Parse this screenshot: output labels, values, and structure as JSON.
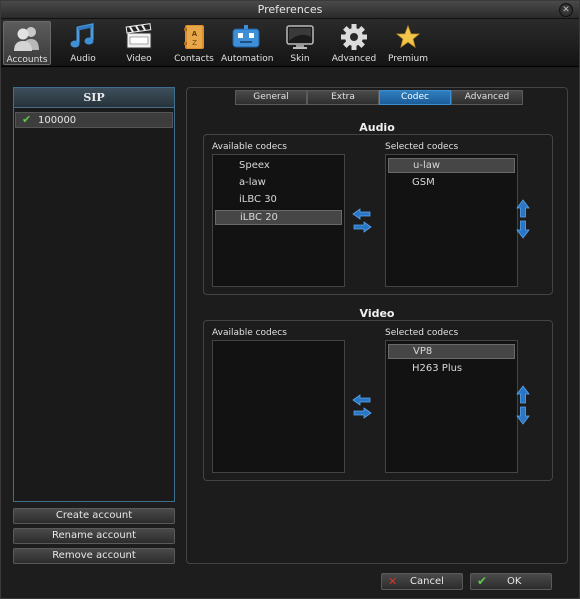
{
  "window": {
    "title": "Preferences",
    "close_glyph": "✕"
  },
  "toolbar": {
    "items": [
      {
        "label": "Accounts",
        "icon": "accounts-icon",
        "active": true
      },
      {
        "label": "Audio",
        "icon": "music-note-icon"
      },
      {
        "label": "Video",
        "icon": "clapperboard-icon"
      },
      {
        "label": "Contacts",
        "icon": "address-book-icon"
      },
      {
        "label": "Automation",
        "icon": "robot-icon"
      },
      {
        "label": "Skin",
        "icon": "monitor-icon"
      },
      {
        "label": "Advanced",
        "icon": "gear-icon"
      },
      {
        "label": "Premium",
        "icon": "star-icon"
      }
    ]
  },
  "accounts": {
    "header": "SIP",
    "list": [
      {
        "name": "100000",
        "checked": true
      }
    ],
    "buttons": {
      "create": "Create account",
      "rename": "Rename account",
      "remove": "Remove account"
    }
  },
  "tabs": [
    {
      "label": "General"
    },
    {
      "label": "Extra"
    },
    {
      "label": "Codec",
      "selected": true
    },
    {
      "label": "Advanced"
    }
  ],
  "audio": {
    "title": "Audio",
    "available_label": "Available codecs",
    "selected_label": "Selected codecs",
    "available": [
      "Speex",
      "a-law",
      "iLBC 30",
      "iLBC 20"
    ],
    "available_selected": "iLBC 20",
    "selected": [
      "u-law",
      "GSM"
    ],
    "selected_selected": "u-law"
  },
  "video": {
    "title": "Video",
    "available_label": "Available codecs",
    "selected_label": "Selected codecs",
    "available": [],
    "selected": [
      "VP8",
      "H263 Plus"
    ],
    "selected_selected": "VP8"
  },
  "footer": {
    "cancel": "Cancel",
    "ok": "OK"
  },
  "colors": {
    "accent": "#1f66b0",
    "tab_selected": "#2672b4",
    "ok_check": "#61c84a",
    "cancel_x": "#d43a2a"
  }
}
